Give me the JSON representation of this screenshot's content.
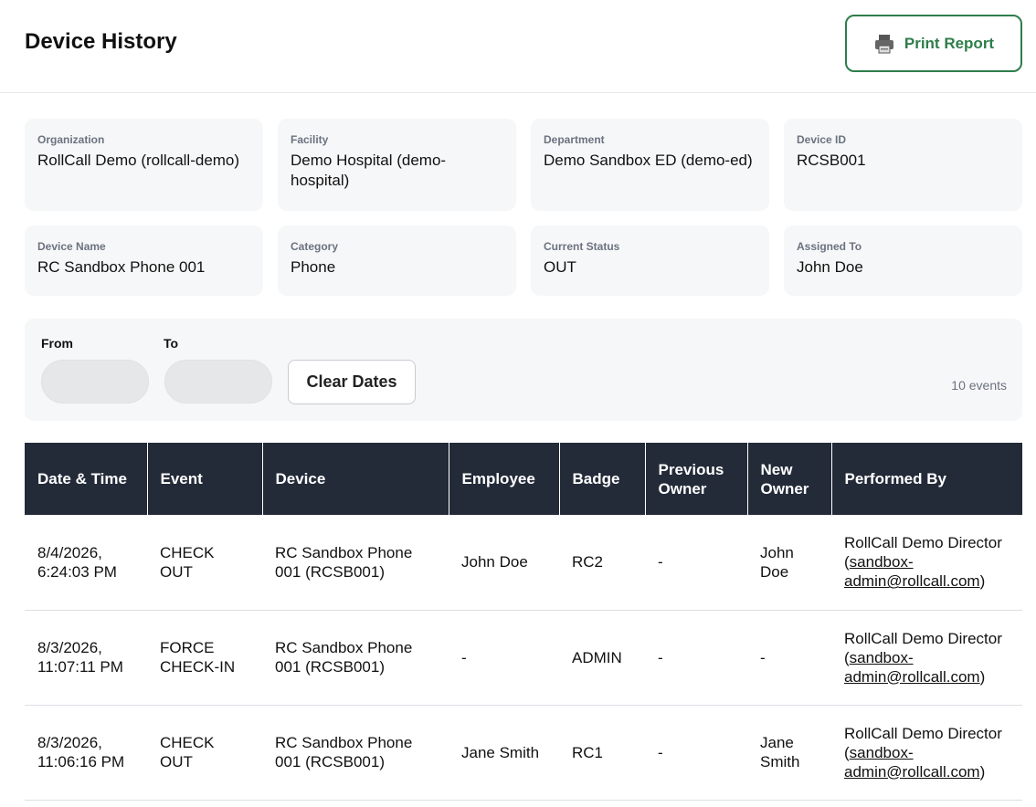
{
  "header": {
    "title": "Device History",
    "print_label": "Print Report",
    "print_icon": "printer-icon"
  },
  "info": {
    "organization": {
      "label": "Organization",
      "value": "RollCall Demo (rollcall-demo)"
    },
    "facility": {
      "label": "Facility",
      "value": "Demo Hospital (demo-hospital)"
    },
    "department": {
      "label": "Department",
      "value": "Demo Sandbox ED (demo-ed)"
    },
    "device_id": {
      "label": "Device ID",
      "value": "RCSB001"
    },
    "device_name": {
      "label": "Device Name",
      "value": "RC Sandbox Phone 001"
    },
    "category": {
      "label": "Category",
      "value": "Phone"
    },
    "current_status": {
      "label": "Current Status",
      "value": "OUT"
    },
    "assigned_to": {
      "label": "Assigned To",
      "value": "John Doe"
    }
  },
  "filter": {
    "from_label": "From",
    "to_label": "To",
    "from_value": "",
    "to_value": "",
    "clear_label": "Clear Dates",
    "event_count": "10 events"
  },
  "table": {
    "columns": [
      "Date & Time",
      "Event",
      "Device",
      "Employee",
      "Badge",
      "Previous Owner",
      "New Owner",
      "Performed By"
    ],
    "rows": [
      {
        "date": "8/4/2026, 6:24:03 PM",
        "event": "CHECK OUT",
        "device": "RC Sandbox Phone 001 (RCSB001)",
        "employee": "John Doe",
        "badge": "RC2",
        "previous_owner": "-",
        "new_owner": "John Doe",
        "performed_by_name": "RollCall Demo Director",
        "performed_by_email": "sandbox-admin@rollcall.com"
      },
      {
        "date": "8/3/2026, 11:07:11 PM",
        "event": "FORCE CHECK-IN",
        "device": "RC Sandbox Phone 001 (RCSB001)",
        "employee": "-",
        "badge": "ADMIN",
        "previous_owner": "-",
        "new_owner": "-",
        "performed_by_name": "RollCall Demo Director",
        "performed_by_email": "sandbox-admin@rollcall.com"
      },
      {
        "date": "8/3/2026, 11:06:16 PM",
        "event": "CHECK OUT",
        "device": "RC Sandbox Phone 001 (RCSB001)",
        "employee": "Jane Smith",
        "badge": "RC1",
        "previous_owner": "-",
        "new_owner": "Jane Smith",
        "performed_by_name": "RollCall Demo Director",
        "performed_by_email": "sandbox-admin@rollcall.com"
      }
    ]
  },
  "colors": {
    "accent_green": "#2e7d4a",
    "table_header": "#232a38",
    "card_bg": "#f6f7f8"
  }
}
